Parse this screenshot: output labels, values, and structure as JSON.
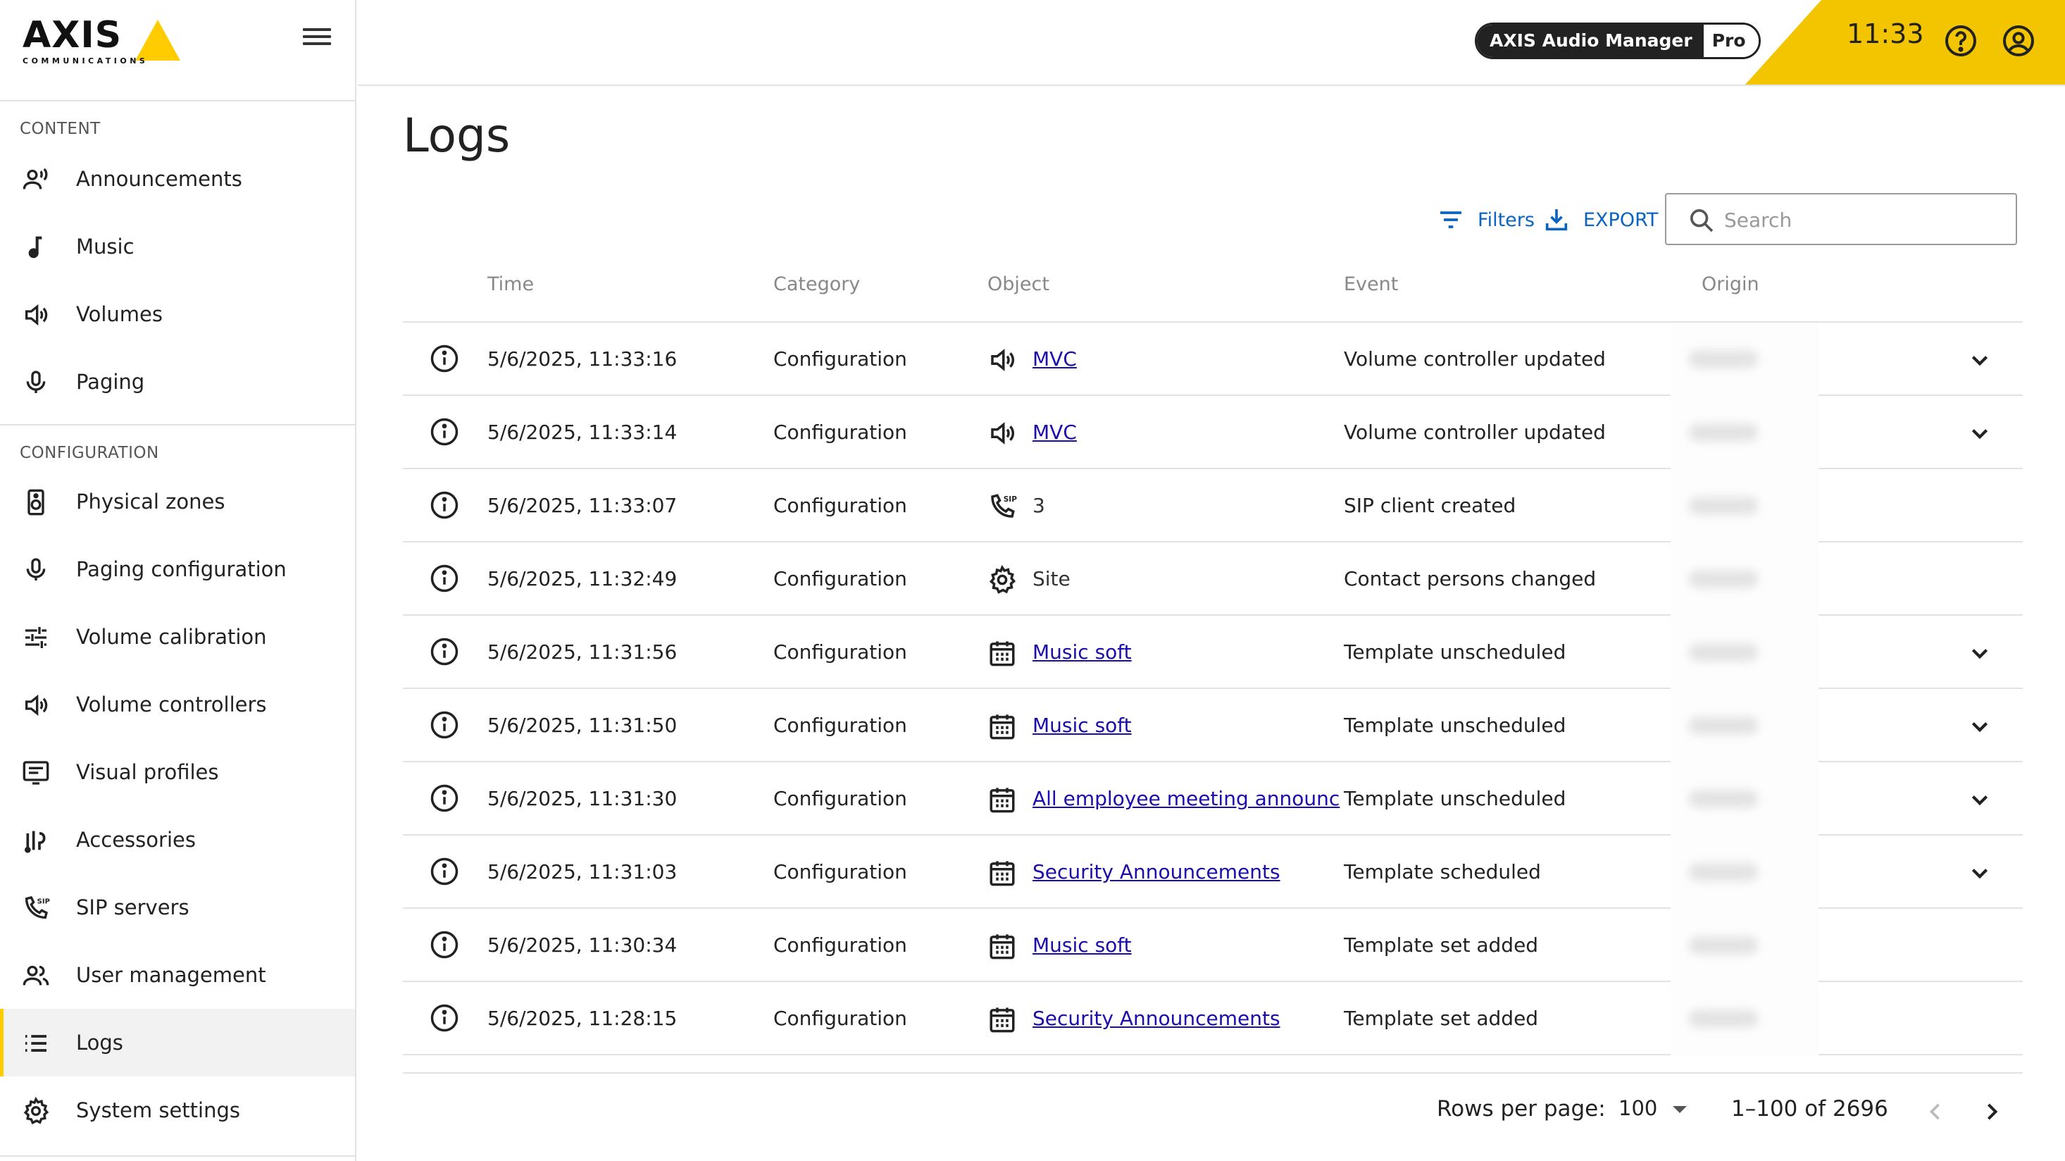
{
  "brand": {
    "logo_text": "AXIS",
    "logo_subtext": "COMMUNICATIONS",
    "accent_color": "#f3c500"
  },
  "header": {
    "product_name": "AXIS Audio Manager",
    "product_tier": "Pro",
    "clock": "11:33",
    "help_icon": "help-circle-icon",
    "account_icon": "account-circle-icon"
  },
  "sidebar": {
    "content_label": "CONTENT",
    "content_items": [
      {
        "label": "Announcements",
        "icon": "announcement-icon"
      },
      {
        "label": "Music",
        "icon": "music-note-icon"
      },
      {
        "label": "Volumes",
        "icon": "speaker-icon"
      },
      {
        "label": "Paging",
        "icon": "microphone-icon"
      }
    ],
    "configuration_label": "CONFIGURATION",
    "configuration_items": [
      {
        "label": "Physical zones",
        "icon": "speaker-box-icon"
      },
      {
        "label": "Paging configuration",
        "icon": "microphone-icon"
      },
      {
        "label": "Volume calibration",
        "icon": "tune-sliders-icon"
      },
      {
        "label": "Volume controllers",
        "icon": "speaker-icon"
      },
      {
        "label": "Visual profiles",
        "icon": "display-text-icon"
      },
      {
        "label": "Accessories",
        "icon": "accessories-icon"
      },
      {
        "label": "SIP servers",
        "icon": "sip-phone-icon"
      },
      {
        "label": "User management",
        "icon": "users-icon"
      },
      {
        "label": "Logs",
        "icon": "list-icon",
        "active": true
      },
      {
        "label": "System settings",
        "icon": "gear-icon"
      }
    ]
  },
  "main": {
    "title": "Logs",
    "filters_label": "Filters",
    "export_label": "EXPORT",
    "search_placeholder": "Search",
    "columns": {
      "time": "Time",
      "category": "Category",
      "object": "Object",
      "event": "Event",
      "origin": "Origin"
    },
    "rows": [
      {
        "time": "5/6/2025, 11:33:16",
        "category": "Configuration",
        "object_icon": "speaker-icon",
        "object": "MVC",
        "object_link": true,
        "event": "Volume controller updated",
        "origin": "Markus",
        "expandable": true
      },
      {
        "time": "5/6/2025, 11:33:14",
        "category": "Configuration",
        "object_icon": "speaker-icon",
        "object": "MVC",
        "object_link": true,
        "event": "Volume controller updated",
        "origin": "Markus",
        "expandable": true
      },
      {
        "time": "5/6/2025, 11:33:07",
        "category": "Configuration",
        "object_icon": "sip-phone-icon",
        "object": "3",
        "object_link": false,
        "event": "SIP client created",
        "origin": "Markus",
        "expandable": false
      },
      {
        "time": "5/6/2025, 11:32:49",
        "category": "Configuration",
        "object_icon": "gear-icon",
        "object": "Site",
        "object_link": false,
        "event": "Contact persons changed",
        "origin": "Markus",
        "expandable": false
      },
      {
        "time": "5/6/2025, 11:31:56",
        "category": "Configuration",
        "object_icon": "calendar-icon",
        "object": "Music soft",
        "object_link": true,
        "event": "Template unscheduled",
        "origin": "Markus",
        "expandable": true
      },
      {
        "time": "5/6/2025, 11:31:50",
        "category": "Configuration",
        "object_icon": "calendar-icon",
        "object": "Music soft",
        "object_link": true,
        "event": "Template unscheduled",
        "origin": "Markus",
        "expandable": true
      },
      {
        "time": "5/6/2025, 11:31:30",
        "category": "Configuration",
        "object_icon": "calendar-icon",
        "object": "All employee meeting announc",
        "object_link": true,
        "event": "Template unscheduled",
        "origin": "Markus",
        "expandable": true
      },
      {
        "time": "5/6/2025, 11:31:03",
        "category": "Configuration",
        "object_icon": "calendar-icon",
        "object": "Security Announcements",
        "object_link": true,
        "event": "Template scheduled",
        "origin": "Markus",
        "expandable": true
      },
      {
        "time": "5/6/2025, 11:30:34",
        "category": "Configuration",
        "object_icon": "calendar-icon",
        "object": "Music soft",
        "object_link": true,
        "event": "Template set added",
        "origin": "Markus",
        "expandable": false
      },
      {
        "time": "5/6/2025, 11:28:15",
        "category": "Configuration",
        "object_icon": "calendar-icon",
        "object": "Security Announcements",
        "object_link": true,
        "event": "Template set added",
        "origin": "Markus",
        "expandable": false
      }
    ]
  },
  "pagination": {
    "rows_per_page_label": "Rows per page:",
    "rows_per_page": "100",
    "range": "1–100 of 2696"
  }
}
